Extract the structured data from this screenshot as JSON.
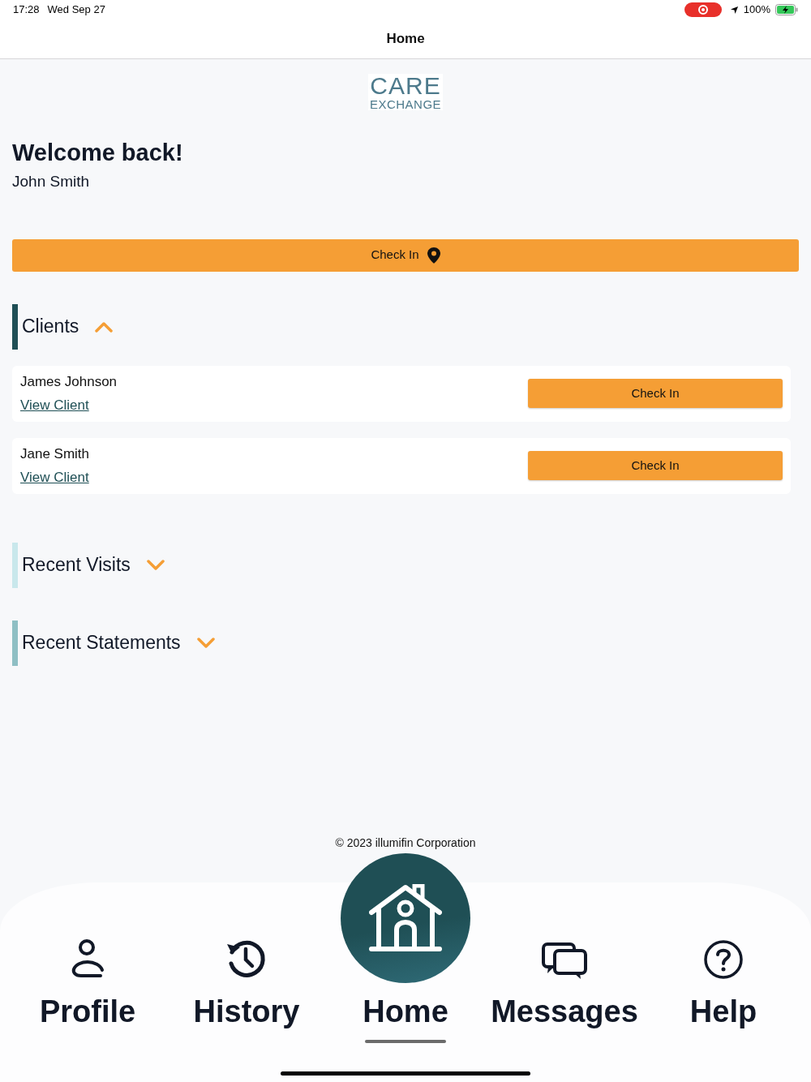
{
  "status_bar": {
    "time": "17:28",
    "date": "Wed Sep 27",
    "recording": true,
    "battery": "100%",
    "charging": true
  },
  "nav_bar": {
    "title": "Home"
  },
  "logo": {
    "line_1": "CARE",
    "line_2": "EXCHANGE"
  },
  "welcome": {
    "heading": "Welcome back!",
    "name": "John Smith"
  },
  "check_in_button": {
    "label": "Check In"
  },
  "sections": [
    {
      "title": "Clients",
      "expanded": true,
      "color": "#1f4f55",
      "clients": [
        {
          "name": "James Johnson",
          "link": "View Client",
          "button": "Check In"
        },
        {
          "name": "Jane Smith",
          "link": "View Client",
          "button": "Check In"
        }
      ]
    },
    {
      "title": "Recent Visits",
      "expanded": false,
      "color": "#c9e8ec"
    },
    {
      "title": "Recent Statements",
      "expanded": false,
      "color": "#8fbfc4"
    }
  ],
  "footer": {
    "copyright": "© 2023 illumifin Corporation"
  },
  "tab_bar": [
    {
      "label": "Profile",
      "kind": "profile",
      "selected": false
    },
    {
      "label": "History",
      "kind": "history",
      "selected": false
    },
    {
      "label": "Home",
      "kind": "home",
      "selected": true
    },
    {
      "label": "Messages",
      "kind": "messages",
      "selected": false
    },
    {
      "label": "Help",
      "kind": "help",
      "selected": false
    }
  ]
}
